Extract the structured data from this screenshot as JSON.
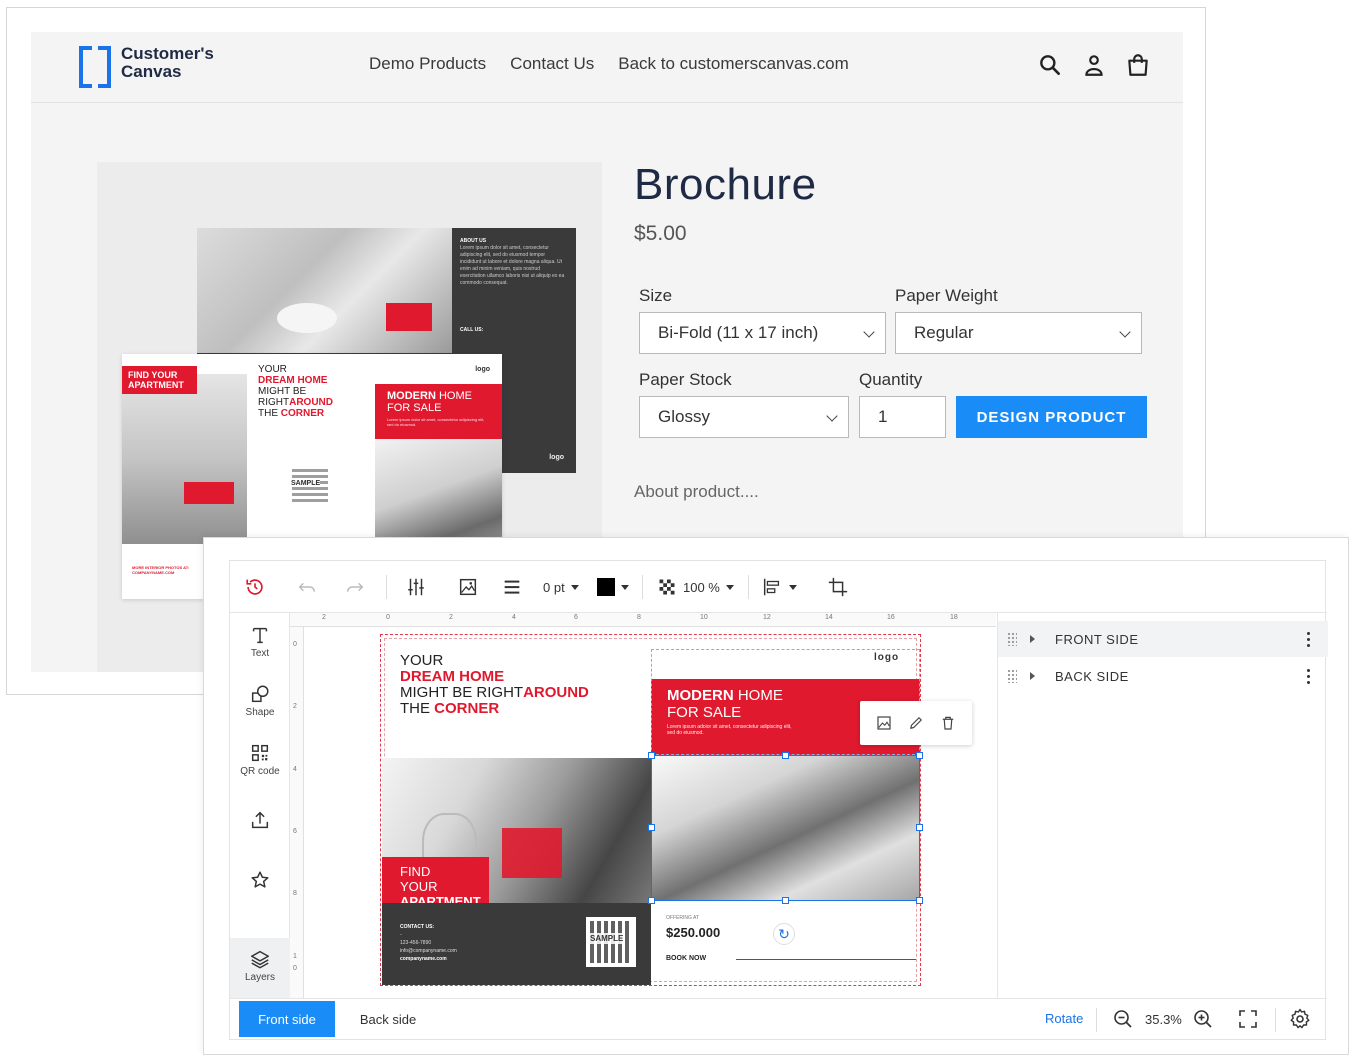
{
  "store": {
    "logo_line1": "Customer's",
    "logo_line2": "Canvas",
    "nav": [
      "Demo Products",
      "Contact Us",
      "Back to customerscanvas.com"
    ],
    "product": {
      "title": "Brochure",
      "price": "$5.00",
      "size_label": "Size",
      "size_value": "Bi-Fold (11 x 17 inch)",
      "weight_label": "Paper Weight",
      "weight_value": "Regular",
      "stock_label": "Paper Stock",
      "stock_value": "Glossy",
      "quantity_label": "Quantity",
      "quantity_value": "1",
      "design_button": "DESIGN PRODUCT",
      "about": "About product...."
    },
    "preview": {
      "back_about_title": "ABOUT US",
      "back_about_text": "Lorem ipsum dolor sit amet, consectetur adipiscing elit, sed do eiusmod tempor incididunt ut labore et dolore magna aliqua. Ut enim ad minim veniam, quis nostrud exercitation ullamco laboris nisi ut aliquip ex ea commodo consequat.",
      "back_call_us": "CALL US:",
      "back_logo": "logo",
      "find_line1": "FIND YOUR",
      "find_line2": "APARTMENT",
      "more_photos_line1": "MORE INTERIOR PHOTOS AT:",
      "more_photos_line2": "COMPANYNAME.COM",
      "head_line1": "YOUR",
      "head_line2": "DREAM HOME",
      "head_line3a": "MIGHT BE",
      "head_line4a": "RIGHT",
      "head_line4b": "AROUND",
      "head_line5a": "THE ",
      "head_line5b": "CORNER",
      "qr_sample": "SAMPLE",
      "front_logo": "logo",
      "modern_a": "MODERN",
      "modern_b": " HOME",
      "for_sale": "FOR SALE",
      "modern_sub": "Lorem ipsum dolor sit amet, consectetur adipiscing elit, sed do eiusmod."
    }
  },
  "editor": {
    "toolbar": {
      "stroke_width": "0 pt",
      "opacity": "100 %"
    },
    "tools": [
      {
        "label": "Text"
      },
      {
        "label": "Shape"
      },
      {
        "label": "QR code"
      },
      {
        "label": ""
      },
      {
        "label": ""
      },
      {
        "label": "Layers"
      }
    ],
    "ruler_top": [
      "2",
      "0",
      "2",
      "4",
      "6",
      "8",
      "10",
      "12",
      "14",
      "16",
      "18"
    ],
    "ruler_left": [
      "0",
      "2",
      "4",
      "6",
      "8",
      "1",
      "0"
    ],
    "doc": {
      "head_line1": "YOUR",
      "head_line2": "DREAM HOME",
      "head_line3a": "MIGHT BE RIGHT",
      "head_line3b": "AROUND",
      "head_line4a": "THE ",
      "head_line4b": "CORNER",
      "find_line1": "FIND YOUR",
      "find_line2": "APARTMENT",
      "contact_title": "CONTACT US:",
      "contact_dash": "-",
      "contact_phone": "123-456-7890",
      "contact_email": "info@companyname.com",
      "contact_site": "companyname.com",
      "qr_sample": "SAMPLE",
      "logo": "logo",
      "modern_a": "MODERN",
      "modern_b": " HOME",
      "for_sale": "FOR SALE",
      "modern_sub": "Lorem ipsum adoior sit amet, consectetur adipiscing elit, sed do eiusmod.",
      "offering": "OFFERING AT",
      "price": "$250.000",
      "book_now": "BOOK NOW"
    },
    "surfaces": [
      {
        "label": "FRONT SIDE"
      },
      {
        "label": "BACK SIDE"
      }
    ],
    "bottom": {
      "front_side": "Front side",
      "back_side": "Back side",
      "rotate": "Rotate",
      "zoom": "35.3%"
    }
  }
}
